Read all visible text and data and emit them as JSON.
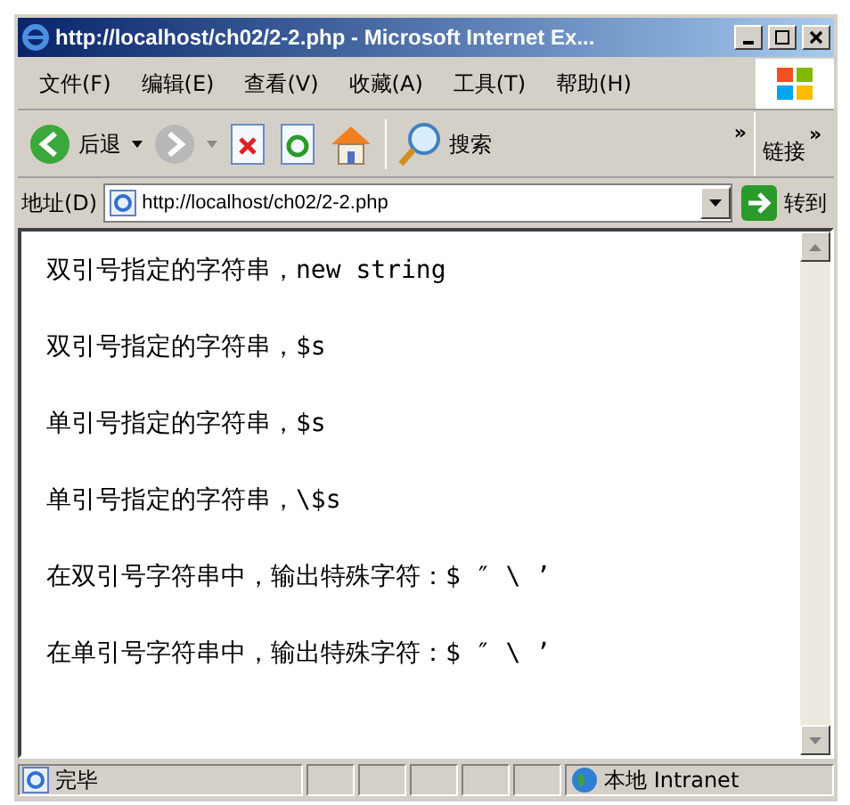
{
  "window": {
    "title": "http://localhost/ch02/2-2.php - Microsoft Internet Ex..."
  },
  "menu": [
    "文件(F)",
    "编辑(E)",
    "查看(V)",
    "收藏(A)",
    "工具(T)",
    "帮助(H)"
  ],
  "toolbar": {
    "back": "后退",
    "search": "搜索",
    "more": "»",
    "links": "链接",
    "links_more": "»"
  },
  "address": {
    "label": "地址(D)",
    "value": "http://localhost/ch02/2-2.php",
    "go": "转到"
  },
  "lines": [
    "双引号指定的字符串，new string",
    "双引号指定的字符串，$s",
    "单引号指定的字符串，$s",
    "单引号指定的字符串，\\$s",
    "在双引号字符串中，输出特殊字符：$ ″ \\ ’",
    "在单引号字符串中，输出特殊字符：$ ″ \\ ’"
  ],
  "status_bar": {
    "text": "完毕",
    "zone": "本地 Intranet"
  }
}
